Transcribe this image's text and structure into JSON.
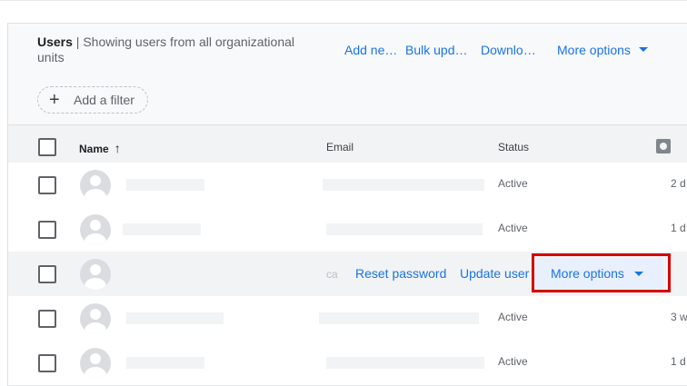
{
  "header": {
    "title_bold": "Users",
    "title_rest": " | Showing users from all organizational units",
    "actions": [
      {
        "label": "Add ne…"
      },
      {
        "label": "Bulk upd…"
      },
      {
        "label": "Downlo…"
      }
    ],
    "more_options": "More options"
  },
  "filter": {
    "plus": "+",
    "label": "Add a filter"
  },
  "columns": {
    "name": "Name",
    "sort_arrow": "↑",
    "email": "Email",
    "status": "Status"
  },
  "rows": [
    {
      "status": "Active",
      "last": "2 d"
    },
    {
      "status": "Active",
      "last": "1 d"
    },
    {
      "email_trunc": "ca"
    },
    {
      "status": "Active",
      "last": "3 w"
    },
    {
      "status": "Active",
      "last": "1 d"
    }
  ],
  "hover_row": {
    "reset_password": "Reset password",
    "update_user": "Update user",
    "more_options": "More options"
  },
  "colors": {
    "accent": "#1a73e8",
    "highlight": "#d50000"
  },
  "icons": {
    "sort": "arrow-up-icon",
    "settings": "gear-icon",
    "avatar": "person-icon",
    "dropdown": "caret-down-icon"
  }
}
